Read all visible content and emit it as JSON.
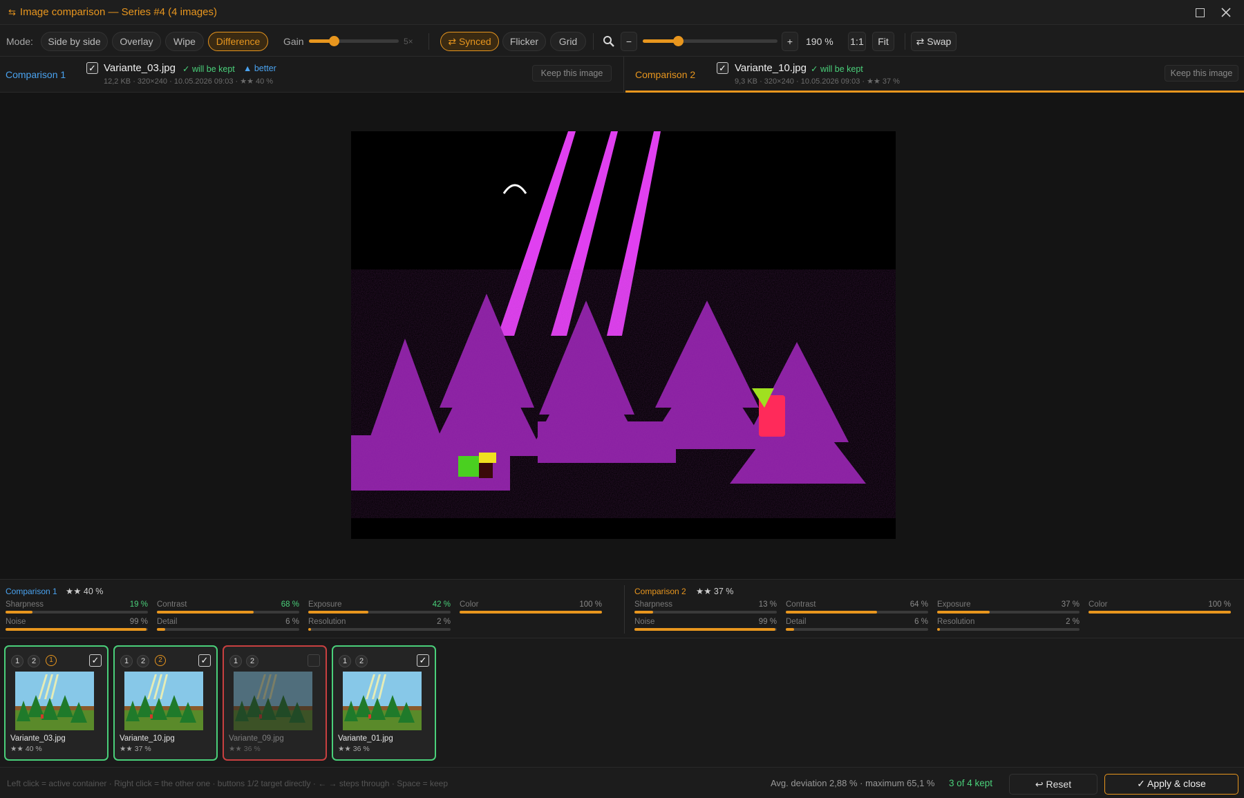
{
  "window": {
    "title": "Image comparison — Series #4 (4 images)",
    "title_icon": "swap-arrows-icon"
  },
  "toolbar": {
    "mode_label": "Mode:",
    "modes": [
      "Side by side",
      "Overlay",
      "Wipe",
      "Difference"
    ],
    "active_mode": "Difference",
    "gain_label": "Gain",
    "gain_max_label": "5×",
    "gain_level": 0.28,
    "synced_label": "⇄ Synced",
    "flicker_label": "Flicker",
    "grid_label": "Grid",
    "zoom_out": "−",
    "zoom_in": "+",
    "zoom_level_fraction": 0.26,
    "zoom_value": "190 %",
    "one_to_one": "1:1",
    "fit": "Fit",
    "swap_label": "⇄ Swap"
  },
  "comparison1": {
    "title": "Comparison 1",
    "filename": "Variante_03.jpg",
    "kept": "✓ will be kept",
    "better": "▲ better",
    "meta": "12,2 KB · 320×240 · 10.05.2026 09:03 · ★★ 40 %",
    "keep_button": "Keep this image"
  },
  "comparison2": {
    "title": "Comparison 2",
    "filename": "Variante_10.jpg",
    "kept": "✓ will be kept",
    "meta": "9,3 KB · 320×240 · 10.05.2026 09:03 · ★★ 37 %",
    "keep_button": "Keep this image"
  },
  "metrics": {
    "left": {
      "title": "Comparison 1",
      "stars": "★★ 40 %",
      "rows": [
        {
          "name": "Sharpness",
          "value": "19 %",
          "level": 0.19,
          "better": true
        },
        {
          "name": "Contrast",
          "value": "68 %",
          "level": 0.68,
          "better": true
        },
        {
          "name": "Exposure",
          "value": "42 %",
          "level": 0.42,
          "better": true
        },
        {
          "name": "Color",
          "value": "100 %",
          "level": 1.0,
          "better": false
        },
        {
          "name": "Noise",
          "value": "99 %",
          "level": 0.99,
          "better": false
        },
        {
          "name": "Detail",
          "value": "6 %",
          "level": 0.06,
          "better": false
        },
        {
          "name": "Resolution",
          "value": "2 %",
          "level": 0.02,
          "better": false
        }
      ]
    },
    "right": {
      "title": "Comparison 2",
      "stars": "★★ 37 %",
      "rows": [
        {
          "name": "Sharpness",
          "value": "13 %",
          "level": 0.13,
          "better": false
        },
        {
          "name": "Contrast",
          "value": "64 %",
          "level": 0.64,
          "better": false
        },
        {
          "name": "Exposure",
          "value": "37 %",
          "level": 0.37,
          "better": false
        },
        {
          "name": "Color",
          "value": "100 %",
          "level": 1.0,
          "better": false
        },
        {
          "name": "Noise",
          "value": "99 %",
          "level": 0.99,
          "better": false
        },
        {
          "name": "Detail",
          "value": "6 %",
          "level": 0.06,
          "better": false
        },
        {
          "name": "Resolution",
          "value": "2 %",
          "level": 0.02,
          "better": false
        }
      ]
    }
  },
  "strip": {
    "chip1": "1",
    "chip2": "2",
    "cards": [
      {
        "name": "Variante_03.jpg",
        "score": "★★ 40 %",
        "rank": "1",
        "checked": true,
        "status": "kept"
      },
      {
        "name": "Variante_10.jpg",
        "score": "★★ 37 %",
        "rank": "2",
        "checked": true,
        "status": "kept"
      },
      {
        "name": "Variante_09.jpg",
        "score": "★★ 36 %",
        "rank": "",
        "checked": false,
        "status": "rejected"
      },
      {
        "name": "Variante_01.jpg",
        "score": "★★ 36 %",
        "rank": "",
        "checked": true,
        "status": "kept"
      }
    ]
  },
  "status": {
    "hint": "Left click = active container · Right click = the other one · buttons 1/2 target directly · ← → steps through · Space = keep",
    "deviation": "Avg. deviation 2,88 % · maximum 65,1 %",
    "kept_count": "3 of 4 kept",
    "reset": "↩ Reset",
    "apply": "✓ Apply & close"
  },
  "colors": {
    "accent": "#e8961e",
    "kept_green": "#4ad07a",
    "better_blue": "#4aa3f0",
    "rejected_red": "#c94040",
    "diff_magenta": "#e040f0",
    "diff_purple": "#8a1fa3"
  }
}
